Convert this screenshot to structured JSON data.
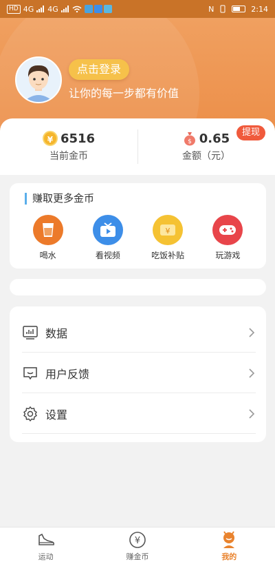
{
  "status_bar": {
    "left_chip": "HD",
    "network_1": "4G",
    "network_2": "4G",
    "time": "2:14"
  },
  "header": {
    "login_button": "点击登录",
    "subtitle": "让你的每一步都有价值"
  },
  "stats": {
    "coins": {
      "value": "6516",
      "label": "当前金币",
      "icon": "coin-icon"
    },
    "amount": {
      "value": "0.65",
      "label": "金额（元）",
      "icon": "money-bag-icon"
    },
    "withdraw": "提现"
  },
  "earn": {
    "title": "赚取更多金币",
    "items": [
      {
        "label": "喝水",
        "icon": "cup-icon",
        "color": "#ec7a2a"
      },
      {
        "label": "看视频",
        "icon": "tv-icon",
        "color": "#3d8ee8"
      },
      {
        "label": "吃饭补贴",
        "icon": "ticket-icon",
        "color": "#f5c233"
      },
      {
        "label": "玩游戏",
        "icon": "gamepad-icon",
        "color": "#e8454a"
      }
    ]
  },
  "menu": {
    "items": [
      {
        "label": "数据",
        "icon": "chart-monitor-icon"
      },
      {
        "label": "用户反馈",
        "icon": "feedback-icon"
      },
      {
        "label": "设置",
        "icon": "gear-icon"
      }
    ]
  },
  "bottom_nav": {
    "items": [
      {
        "label": "运动",
        "icon": "shoe-icon"
      },
      {
        "label": "赚金币",
        "icon": "yuan-coin-icon"
      },
      {
        "label": "我的",
        "icon": "profile-icon",
        "active": true
      }
    ]
  },
  "colors": {
    "header": "#ec8e48",
    "accent": "#e9832e",
    "withdraw": "#f05a3c",
    "title_bar": "#5aaeea"
  }
}
